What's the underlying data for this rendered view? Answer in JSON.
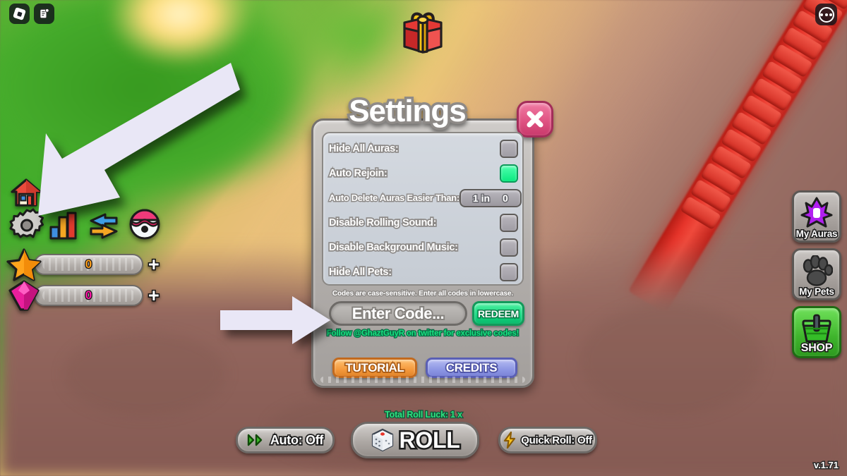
{
  "topbar": {
    "roblox_logo_icon": "roblox-logo-icon",
    "chat_icon": "chat-icon",
    "more_icon": "more-options-icon"
  },
  "gift": {
    "icon": "gift-box-icon"
  },
  "left_sidebar": {
    "items": [
      {
        "name": "home",
        "icon": "home-icon"
      },
      {
        "name": "settings",
        "icon": "gear-icon"
      },
      {
        "name": "stats",
        "icon": "bar-chart-icon"
      },
      {
        "name": "trade",
        "icon": "trade-arrows-icon"
      },
      {
        "name": "index",
        "icon": "egg-icon"
      }
    ],
    "currencies": [
      {
        "name": "stars",
        "icon": "star-icon",
        "value": "0",
        "color": "#ff9f1c",
        "plus": "+"
      },
      {
        "name": "gems",
        "icon": "gem-icon",
        "value": "0",
        "color": "#ff18a8",
        "plus": "+"
      }
    ]
  },
  "right_sidebar": {
    "buttons": [
      {
        "label": "My Auras",
        "icon": "aura-icon"
      },
      {
        "label": "My Pets",
        "icon": "paw-icon"
      },
      {
        "label": "SHOP",
        "icon": "shop-basket-icon"
      }
    ]
  },
  "settings": {
    "title": "Settings",
    "close_icon": "close-icon",
    "rows": [
      {
        "label": "Hide All Auras:",
        "type": "toggle",
        "value": "off"
      },
      {
        "label": "Auto Rejoin:",
        "type": "toggle",
        "value": "on"
      },
      {
        "label": "Auto Delete Auras Easier Than:",
        "type": "number",
        "prefix": "1 in",
        "value": "0"
      },
      {
        "label": "Disable Rolling Sound:",
        "type": "toggle",
        "value": "off"
      },
      {
        "label": "Disable Background Music:",
        "type": "toggle",
        "value": "off"
      },
      {
        "label": "Hide All Pets:",
        "type": "toggle",
        "value": "off"
      }
    ],
    "codes_note": "Codes are case-sensitive. Enter all codes in lowercase.",
    "code_placeholder": "Enter Code...",
    "redeem_label": "REDEEM",
    "follow_note": "Follow @GhaztGuyR on twitter for exclusive codes!",
    "tutorial_label": "TUTORIAL",
    "credits_label": "CREDITS",
    "toggle_on_color": "#12e68a",
    "toggle_off_color": "#adaab0"
  },
  "bottom_bar": {
    "luck_text": "Total Roll Luck: 1 x",
    "auto_label": "Auto: Off",
    "auto_icon": "double-chevron-icon",
    "roll_label": "ROLL",
    "roll_icon": "dice-icon",
    "quick_label": "Quick Roll: Off",
    "quick_icon": "lightning-icon"
  },
  "version": "v.1.71",
  "annotations": {
    "arrow_to_gear": "arrow-pointing-down-left",
    "arrow_to_code": "arrow-pointing-right",
    "arrow_color": "#e8e6f5"
  }
}
